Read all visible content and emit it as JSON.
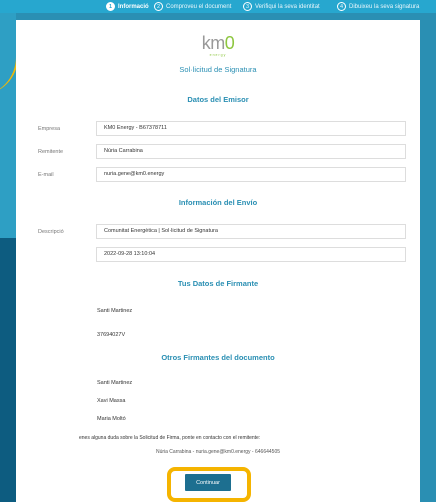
{
  "stepper": {
    "steps": [
      {
        "num": "1",
        "label": "Informació",
        "active": true
      },
      {
        "num": "2",
        "label": "Comproveu el document",
        "active": false
      },
      {
        "num": "3",
        "label": "Verifiqui la seva identitat",
        "active": false
      },
      {
        "num": "4",
        "label": "Dibuixeu la seva signatura",
        "active": false
      }
    ]
  },
  "header": {
    "logo_text_a": "km",
    "logo_text_b": "0",
    "logo_sub": "energy",
    "title": "Sol·licitud de Signatura"
  },
  "issuer": {
    "heading": "Datos del Emisor",
    "rows": [
      {
        "label": "Empresa",
        "value": "KM0 Energy - B67378711"
      },
      {
        "label": "Remitente",
        "value": "Núria Carrabina"
      },
      {
        "label": "E-mail",
        "value": "nuria.gene@km0.energy"
      }
    ]
  },
  "shipment": {
    "heading": "Información del Envío",
    "rows": [
      {
        "label": "Descripció",
        "value": "Comunitat Energètica | Sol·licitud de Signatura"
      },
      {
        "label": "",
        "value": "2022-09-28 13:10:04"
      }
    ]
  },
  "signer": {
    "heading": "Tus Datos de Firmante",
    "rows": [
      {
        "value": "Santi Martinez"
      },
      {
        "value": "37694027V"
      }
    ]
  },
  "others": {
    "heading": "Otros Firmantes del documento",
    "names": [
      "Santi Martinez",
      "Xavi Massa",
      "Maria Moltó"
    ]
  },
  "footer": {
    "note": "enes alguna duda sobre la Solicitud de Firma, ponte en contacto con el remitente:",
    "contact": "Núria Carrabina - nuria.gene@km0.energy - 646644505",
    "continue_label": "Continuar"
  },
  "colors": {
    "accent": "#2a8fb3",
    "highlight": "#f5b400",
    "button": "#1d6f90",
    "brand_green": "#8dc63f"
  }
}
